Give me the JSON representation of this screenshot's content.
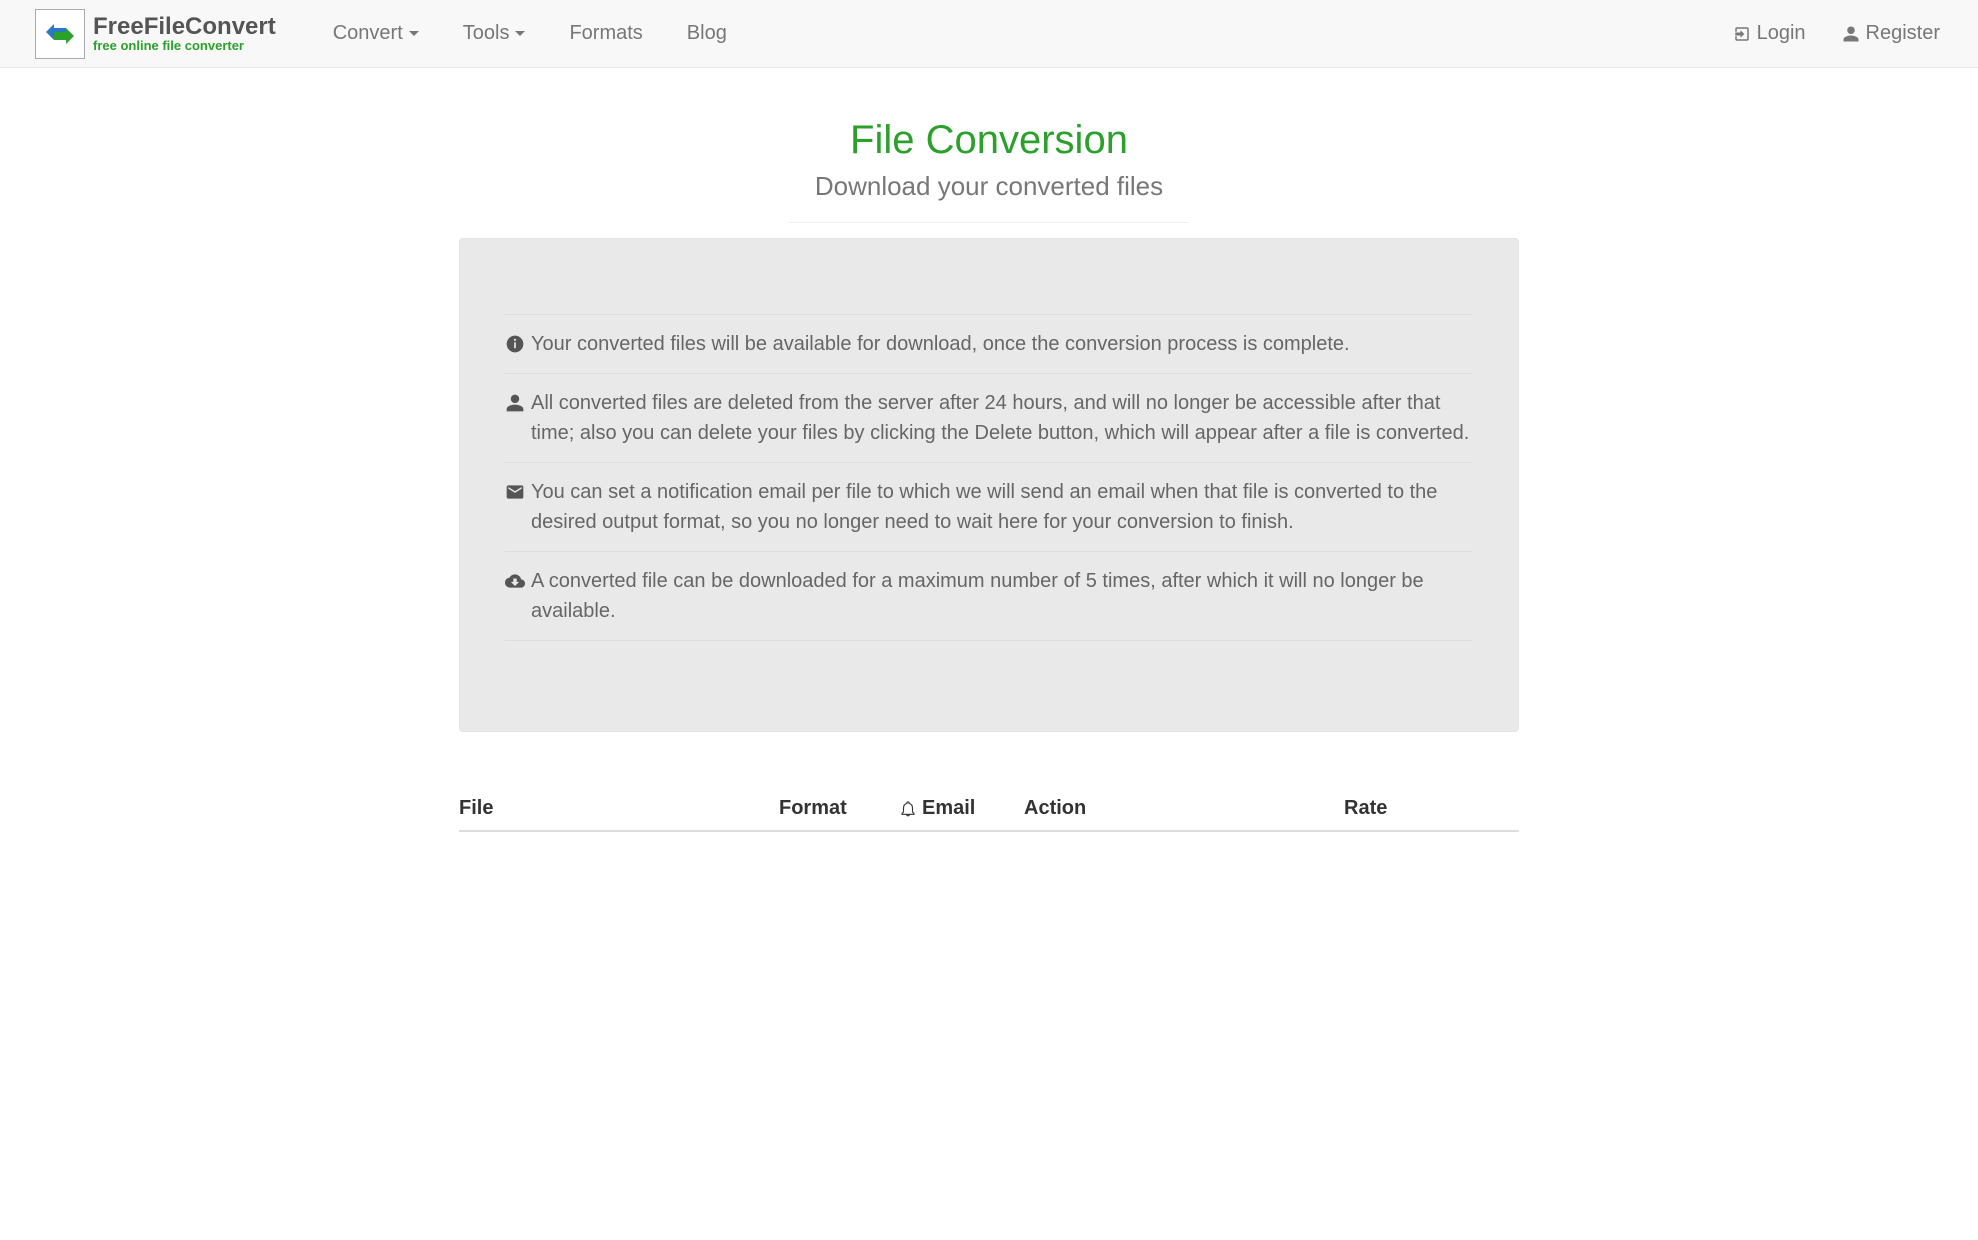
{
  "brand": {
    "title": "FreeFileConvert",
    "sub": "free online file converter"
  },
  "nav": {
    "convert": "Convert",
    "tools": "Tools",
    "formats": "Formats",
    "blog": "Blog",
    "login": "Login",
    "register": "Register"
  },
  "page": {
    "title": "File Conversion",
    "subtitle": "Download your converted files"
  },
  "notes": {
    "item1": "Your converted files will be available for download, once the conversion process is complete.",
    "item2": "All converted files are deleted from the server after 24 hours, and will no longer be accessible after that time; also you can delete your files by clicking the Delete button, which will appear after a file is converted.",
    "item3": "You can set a notification email per file to which we will send an email when that file is converted to the desired output format, so you no longer need to wait here for your conversion to finish.",
    "item4": "A converted file can be downloaded for a maximum number of 5 times, after which it will no longer be available."
  },
  "table": {
    "file": "File",
    "format": "Format",
    "email": "Email",
    "action": "Action",
    "rate": "Rate"
  }
}
